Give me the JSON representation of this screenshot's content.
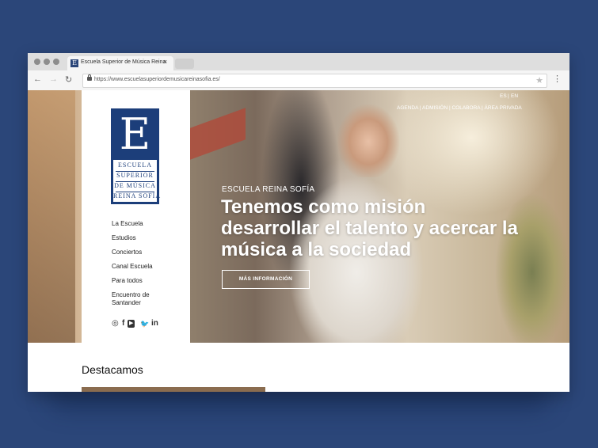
{
  "browser": {
    "tab_title": "Escuela Superior de Música Reina",
    "tab_close": "×",
    "url": "https://www.escuelasuperiordemusicareinasofia.es/",
    "icons": {
      "back": "back-arrow-icon",
      "forward": "forward-arrow-icon",
      "reload": "reload-icon",
      "lock": "lock-icon",
      "bookmark": "star-icon",
      "menu": "kebab-menu-icon"
    }
  },
  "site": {
    "logo": {
      "letter": "E",
      "lines": [
        "ESCUELA",
        "SUPERIOR",
        "DE MÚSICA",
        "REINA SOFÍA"
      ]
    },
    "menu": [
      "La Escuela",
      "Estudios",
      "Conciertos",
      "Canal Escuela",
      "Para todos",
      "Encuentro de",
      "Santander"
    ],
    "social_icons": [
      "instagram-icon",
      "facebook-icon",
      "youtube-icon",
      "twitter-icon",
      "linkedin-icon"
    ],
    "social_glyphs": {
      "instagram": "◎",
      "facebook": "f",
      "youtube": "▶",
      "twitter": "🐦",
      "linkedin": "in"
    },
    "lang": {
      "es": "ES",
      "sep": "|",
      "en": "EN"
    },
    "topnav": "AGENDA | ADMISIÓN | COLABORA | ÁREA PRIVADA",
    "hero": {
      "eyebrow": "ESCUELA REINA SOFÍA",
      "headline": "Tenemos como misión desarrollar el talento y acercar la música a la sociedad",
      "cta": "MÁS INFORMACIÓN"
    },
    "featured_heading": "Destacamos"
  },
  "colors": {
    "background": "#2b4679",
    "brand_blue": "#1c3e7a"
  }
}
